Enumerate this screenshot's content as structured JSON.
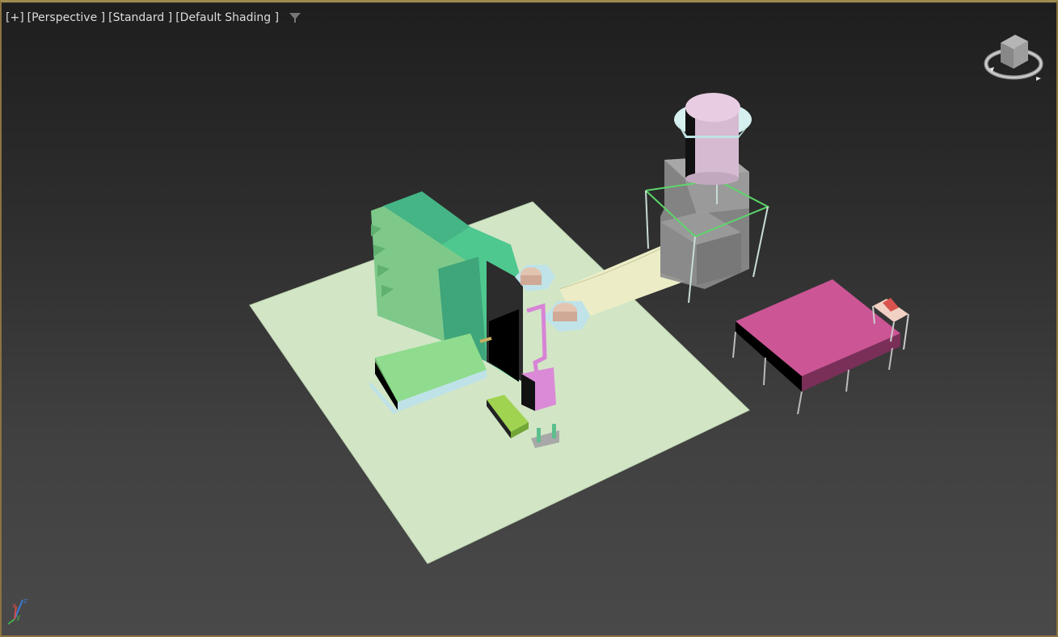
{
  "viewport": {
    "labels": {
      "plus": "[+]",
      "view": "[Perspective ]",
      "style": "[Standard ]",
      "shading": "[Default Shading ]"
    },
    "filter_icon": "filter-funnel-icon",
    "viewcube_icon": "viewcube-icon",
    "axis_gizmo": {
      "x": "x",
      "y": "y",
      "z": "z"
    }
  },
  "colors": {
    "background_top": "#1e1e1e",
    "background_bottom": "#494949",
    "active_border": "#8a7440",
    "ground_plane": "#d2e6c6",
    "machine_green": "#4ec98f",
    "pink_table": "#cc5596",
    "pipe": "#ecedc6",
    "tower_cap": "#e6c8dd"
  }
}
